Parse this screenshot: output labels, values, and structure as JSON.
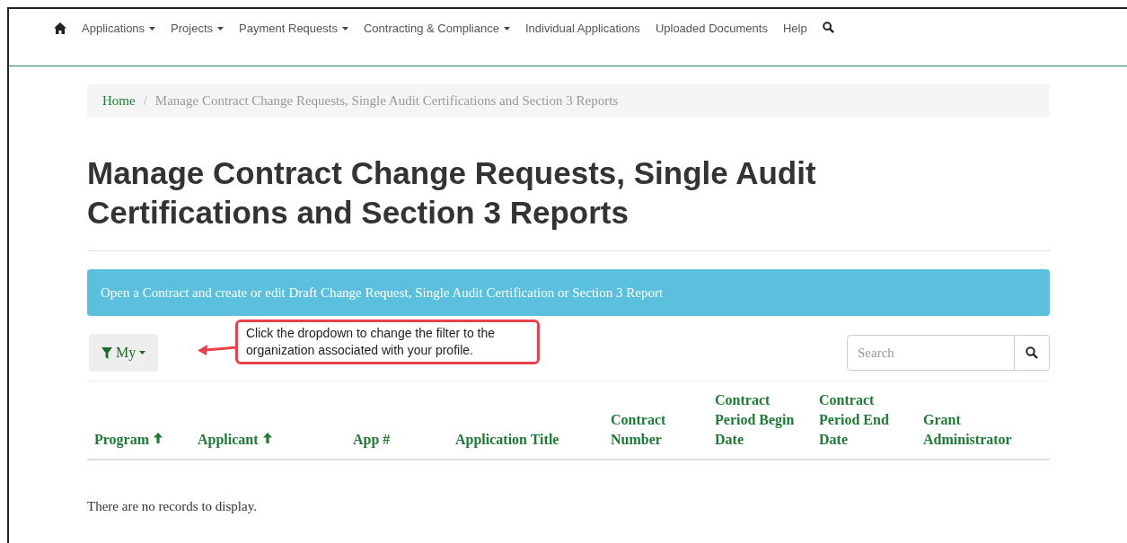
{
  "nav": {
    "items": [
      {
        "label": "Applications",
        "dropdown": true
      },
      {
        "label": "Projects",
        "dropdown": true
      },
      {
        "label": "Payment Requests",
        "dropdown": true
      },
      {
        "label": "Contracting & Compliance",
        "dropdown": true
      },
      {
        "label": "Individual Applications",
        "dropdown": false
      },
      {
        "label": "Uploaded Documents",
        "dropdown": false
      },
      {
        "label": "Help",
        "dropdown": false
      }
    ]
  },
  "breadcrumb_separator": "/",
  "breadcrumb": [
    "Home",
    "Manage Contract Change Requests, Single Audit Certifications and Section 3 Reports"
  ],
  "heading": "Manage Contract Change Requests, Single Audit Certifications and Section 3 Reports",
  "info_banner": "Open a Contract and create or edit Draft Change Request, Single Audit Certification or Section 3 Report",
  "filter_button": "My",
  "callout": "Click the dropdown to change the filter to the organization associated with your profile.",
  "search": {
    "placeholder": "Search"
  },
  "table": {
    "columns": [
      {
        "label": "Program",
        "sorted": true
      },
      {
        "label": "Applicant",
        "sorted": true
      },
      {
        "label": "App #",
        "sorted": false
      },
      {
        "label": "Application Title",
        "sorted": false
      },
      {
        "label": "Contract Number",
        "sorted": false
      },
      {
        "label": "Contract Period Begin Date",
        "sorted": false
      },
      {
        "label": "Contract Period End Date",
        "sorted": false
      },
      {
        "label": "Grant Administrator",
        "sorted": false
      }
    ],
    "empty_message": "There are no records to display."
  }
}
